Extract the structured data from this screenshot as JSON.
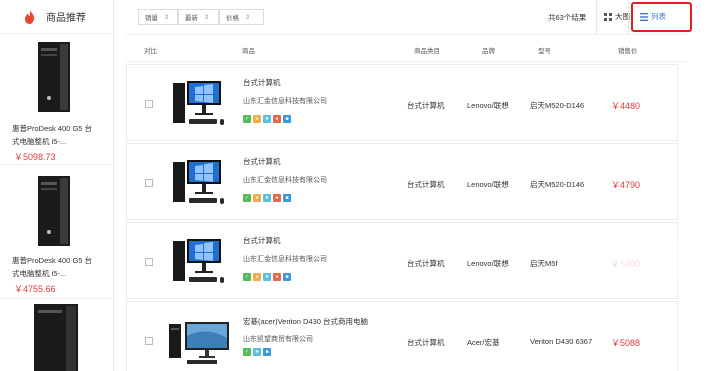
{
  "sidebar": {
    "title": "商品推荐",
    "items": [
      {
        "name_line1": "惠普ProDesk 400 G5 台",
        "name_line2": "式电脑整机 i5-...",
        "price": "￥5098.73"
      },
      {
        "name_line1": "惠普ProDesk 400 G5 台",
        "name_line2": "式电脑整机 i5-...",
        "price": "￥4755.66"
      }
    ]
  },
  "toolbar": {
    "sort_sales": "销量",
    "sort_newest": "最新",
    "sort_price": "价格",
    "total": "共63个结果",
    "view_grid": "大图",
    "view_list": "列表"
  },
  "table": {
    "headers": {
      "compare": "对比",
      "product": "商品",
      "category": "商品类目",
      "brand": "品牌",
      "model": "型号",
      "price": "销售价"
    },
    "rows": [
      {
        "name": "台式计算机",
        "shop": "山东汇金信息科技有限公司",
        "category": "台式计算机",
        "brand": "Lenovo/联想",
        "model": "启天M520-D146",
        "price": "￥4480"
      },
      {
        "name": "台式计算机",
        "shop": "山东汇金信息科技有限公司",
        "category": "台式计算机",
        "brand": "Lenovo/联想",
        "model": "启天M520-D146",
        "price": "￥4790"
      },
      {
        "name": "台式计算机",
        "shop": "山东汇金信息科技有限公司",
        "category": "台式计算机",
        "brand": "Lenovo/联想",
        "model": "启天M5f",
        "price": "￥5400"
      },
      {
        "name": "宏碁(acer)Veriton D430 台式商用电脑",
        "shop": "山东凯望商贸有限公司",
        "category": "台式计算机",
        "brand": "Acer/宏基",
        "model": "Veriton D430 6367",
        "price": "￥5088"
      }
    ]
  },
  "colors": {
    "accent": "#3a78d8",
    "price": "#e4393c",
    "highlight_box": "#e02020"
  }
}
